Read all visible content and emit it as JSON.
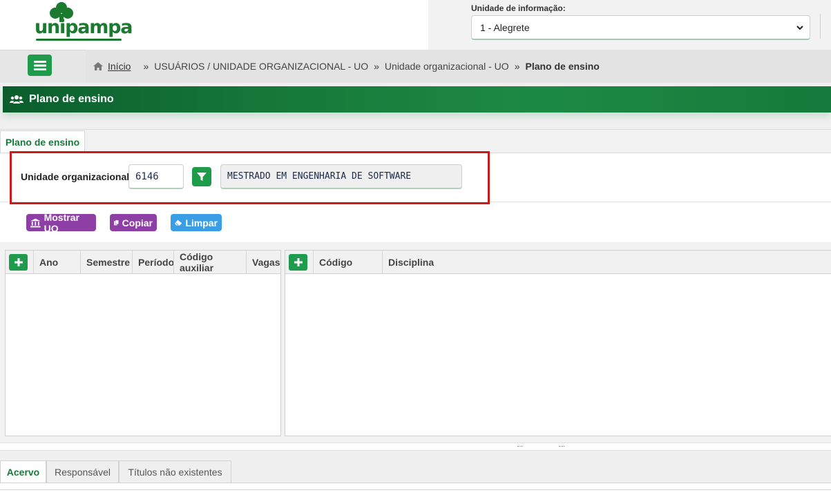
{
  "header": {
    "logo_text": "unipampa",
    "unit_label": "Unidade de informação:",
    "unit_selected": "1 - Alegrete"
  },
  "breadcrumb": {
    "home": "Início",
    "items": [
      "USUÁRIOS / UNIDADE ORGANIZACIONAL - UO",
      "Unidade organizacional - UO"
    ],
    "current": "Plano de ensino",
    "separator": "»"
  },
  "page": {
    "title": "Plano de ensino",
    "tab_label": "Plano de ensino"
  },
  "form": {
    "uo_label": "Unidade organizacional:",
    "uo_code": "6146",
    "uo_name": "MESTRADO EM ENGENHARIA DE SOFTWARE"
  },
  "actions": {
    "mostrar": "Mostrar UO",
    "copiar": "Copiar",
    "limpar": "Limpar"
  },
  "grid_left": {
    "columns": [
      "Ano",
      "Semestre",
      "Período",
      "Código auxiliar",
      "Vagas"
    ]
  },
  "grid_right": {
    "columns": [
      "Código",
      "Disciplina"
    ]
  },
  "bottom_tabs": [
    "Acervo",
    "Responsável",
    "Títulos não existentes"
  ],
  "colors": {
    "primary_green": "#1e9b4b",
    "purple": "#8e3fa6",
    "blue": "#3a9ee6",
    "highlight_red": "#cc1a1a"
  },
  "icons": {
    "menu": "hamburger-icon",
    "home": "home-icon",
    "users": "users-icon",
    "filter": "filter-icon",
    "mostrar": "bank-icon",
    "copiar": "copy-icon",
    "limpar": "eraser-icon",
    "add": "plus-icon",
    "select": "chevron-down-icon"
  }
}
